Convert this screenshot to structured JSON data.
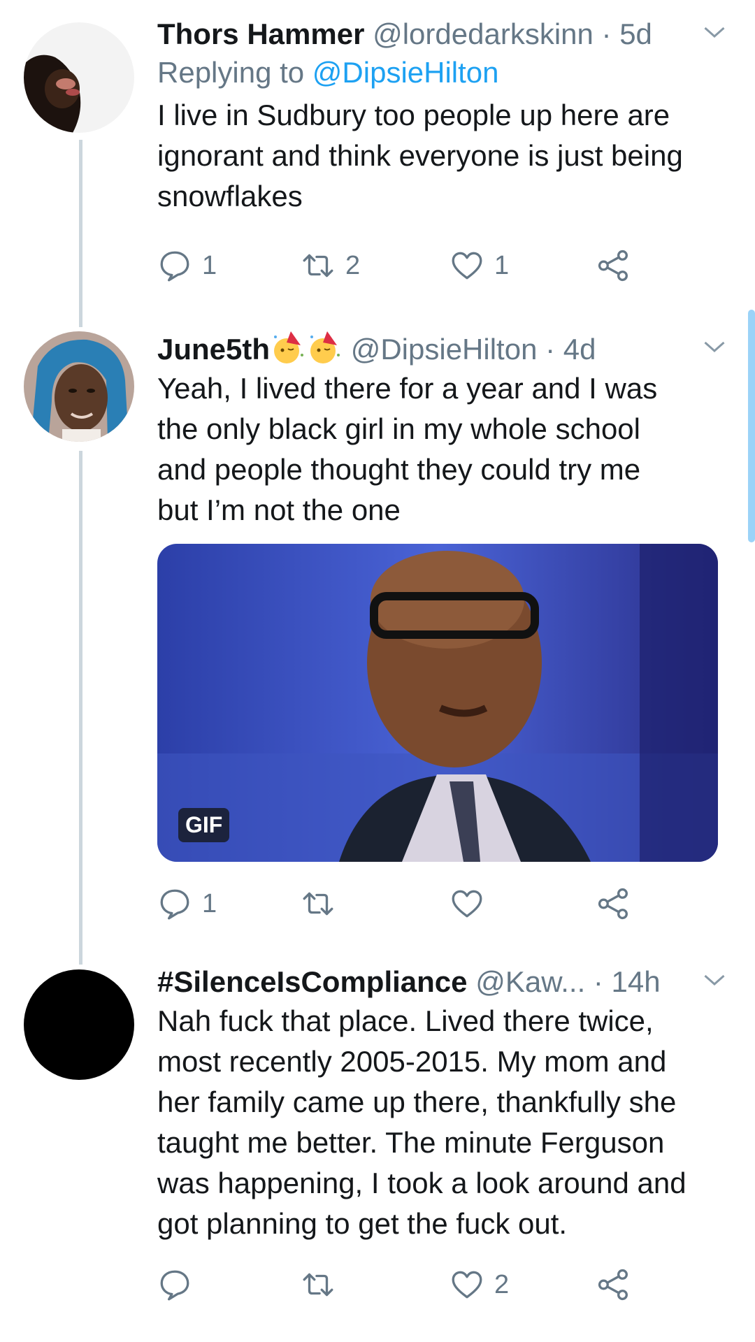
{
  "tweets": [
    {
      "name": "Thors Hammer",
      "handle": "@lordedarkskinn",
      "time": "· 5d",
      "replying_prefix": "Replying to",
      "replying_to": "@DipsieHilton",
      "text": "I live in Sudbury too people up here are\nignorant and think everyone is just being\nsnowflakes",
      "reply_count": "1",
      "retweet_count": "2",
      "like_count": "1"
    },
    {
      "name": "June5th",
      "handle": "@DipsieHilton",
      "time": "· 4d",
      "text": "Yeah, I lived there for a year and I was\nthe only black girl in my whole school\nand people thought they could try me\nbut I’m not the one",
      "gif_badge": "GIF",
      "reply_count": "1",
      "retweet_count": "",
      "like_count": ""
    },
    {
      "name": "#SilenceIsCompliance",
      "handle": "@Kaw...",
      "time": "· 14h",
      "text": "Nah fuck that place. Lived there twice,\nmost recently 2005-2015. My mom and\nher family came up there, thankfully she\ntaught me better. The minute Ferguson\nwas happening, I took a look around and\ngot planning to get the fuck out.",
      "reply_count": "",
      "retweet_count": "",
      "like_count": "2"
    }
  ],
  "icons": {
    "reply": "reply-icon",
    "retweet": "retweet-icon",
    "like": "heart-icon",
    "share": "share-icon",
    "more": "chevron-down-icon"
  },
  "colors": {
    "link": "#1da1f2",
    "meta": "#657786",
    "thread_line": "#ccd6dd",
    "scrollbar": "#9bd3f8"
  }
}
